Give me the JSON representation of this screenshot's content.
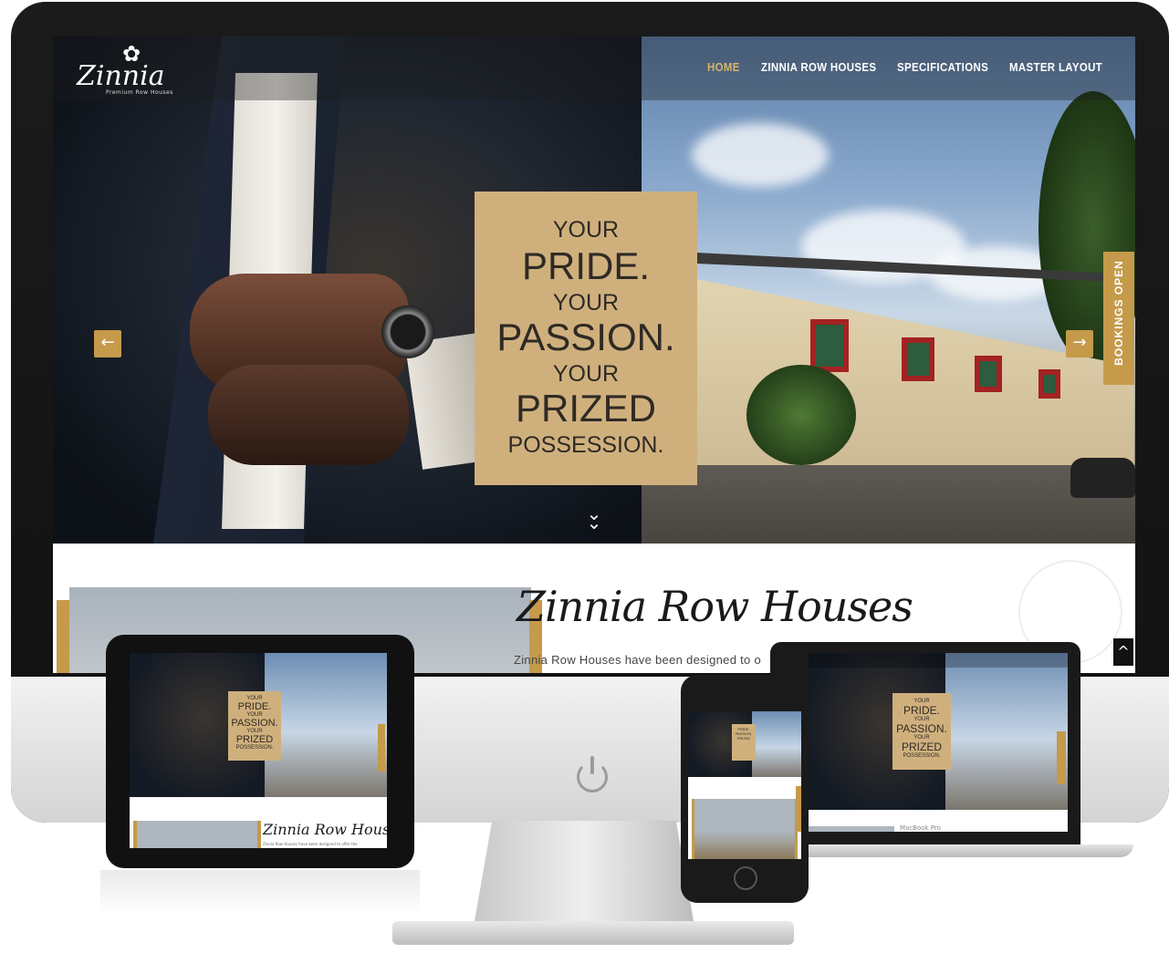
{
  "brand": {
    "logo_text": "Zinnia",
    "logo_tagline": "Premium Row Houses"
  },
  "nav": {
    "home": "HOME",
    "row_houses": "ZINNIA ROW HOUSES",
    "specifications": "SPECIFICATIONS",
    "master_layout": "MASTER LAYOUT"
  },
  "hero": {
    "line1": "YOUR",
    "line2": "PRIDE.",
    "line3": "YOUR",
    "line4": "PASSION.",
    "line5": "YOUR",
    "line6": "PRIZED",
    "line7": "POSSESSION.",
    "prev_arrow": "←",
    "next_arrow": "→",
    "bookings": "BOOKINGS OPEN",
    "scroll_down": "⌄"
  },
  "about": {
    "title": "Zinnia Row Houses",
    "text": "Zinnia Row Houses have been designed to o",
    "tablet_text": "Zinnia Row Houses have been designed to offer the",
    "scroll_top": "^"
  },
  "laptop": {
    "label": "MacBook Pro"
  },
  "colors": {
    "gold": "#c59a4a",
    "tag_bg": "#cfb07d",
    "nav_active": "#d8b56b"
  },
  "icons": {
    "power": "power-icon",
    "prev": "arrow-left-icon",
    "next": "arrow-right-icon",
    "scroll": "chevron-up-icon"
  }
}
